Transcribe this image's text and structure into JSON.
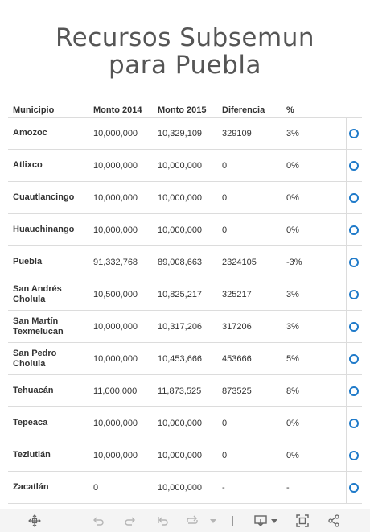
{
  "title": {
    "line1": "Recursos Subsemun",
    "line2": "para Puebla"
  },
  "table": {
    "headers": [
      "Municipio",
      "Monto 2014",
      "Monto 2015",
      "Diferencia",
      "%"
    ],
    "rows": [
      {
        "municipio": "Amozoc",
        "monto2014": "10,000,000",
        "monto2015": "10,329,109",
        "diferencia": "329109",
        "pct": "3%"
      },
      {
        "municipio": "Atlixco",
        "monto2014": "10,000,000",
        "monto2015": "10,000,000",
        "diferencia": "0",
        "pct": "0%"
      },
      {
        "municipio": "Cuautlancingo",
        "monto2014": "10,000,000",
        "monto2015": "10,000,000",
        "diferencia": "0",
        "pct": "0%"
      },
      {
        "municipio": "Huauchinango",
        "monto2014": "10,000,000",
        "monto2015": "10,000,000",
        "diferencia": "0",
        "pct": "0%"
      },
      {
        "municipio": "Puebla",
        "monto2014": "91,332,768",
        "monto2015": "89,008,663",
        "diferencia": "2324105",
        "pct": "-3%"
      },
      {
        "municipio": "San Andrés Cholula",
        "monto2014": "10,500,000",
        "monto2015": "10,825,217",
        "diferencia": "325217",
        "pct": "3%"
      },
      {
        "municipio": "San Martín Texmelucan",
        "monto2014": "10,000,000",
        "monto2015": "10,317,206",
        "diferencia": "317206",
        "pct": "3%"
      },
      {
        "municipio": "San Pedro Cholula",
        "monto2014": "10,000,000",
        "monto2015": "10,453,666",
        "diferencia": "453666",
        "pct": "5%"
      },
      {
        "municipio": "Tehuacán",
        "monto2014": "11,000,000",
        "monto2015": "11,873,525",
        "diferencia": "873525",
        "pct": "8%"
      },
      {
        "municipio": "Tepeaca",
        "monto2014": "10,000,000",
        "monto2015": "10,000,000",
        "diferencia": "0",
        "pct": "0%"
      },
      {
        "municipio": "Teziutlán",
        "monto2014": "10,000,000",
        "monto2015": "10,000,000",
        "diferencia": "0",
        "pct": "0%"
      },
      {
        "municipio": "Zacatlán",
        "monto2014": "0",
        "monto2015": "10,000,000",
        "diferencia": "-",
        "pct": "-"
      }
    ]
  },
  "colors": {
    "accent": "#1f7ac9",
    "title": "#555555",
    "border": "#dcdcdc",
    "toolbar_bg": "#f4f4f4"
  },
  "toolbar": {
    "icons": [
      "pan-icon",
      "undo-icon",
      "redo-icon",
      "revert-icon",
      "refresh-icon",
      "refresh-dropdown-icon",
      "download-icon",
      "fullscreen-icon",
      "share-icon"
    ]
  }
}
